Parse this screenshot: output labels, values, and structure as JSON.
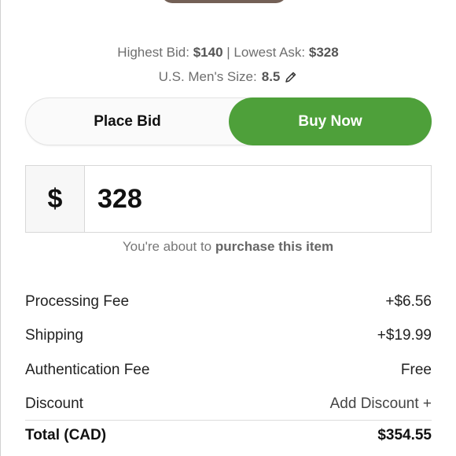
{
  "summary": {
    "highest_bid_label": "Highest Bid:",
    "highest_bid_value": "$140",
    "separator": "|",
    "lowest_ask_label": "Lowest Ask:",
    "lowest_ask_value": "$328",
    "size_label": "U.S. Men's Size:",
    "size_value": "8.5"
  },
  "mode_toggle": {
    "place_bid_label": "Place Bid",
    "buy_now_label": "Buy Now",
    "active": "Buy Now",
    "active_color": "#4ea03a"
  },
  "price_input": {
    "currency_symbol": "$",
    "value": "328"
  },
  "note": {
    "prefix": "You're about to",
    "emphasis": "purchase this item"
  },
  "fees": [
    {
      "label": "Processing Fee",
      "value": "+$6.56"
    },
    {
      "label": "Shipping",
      "value": "+$19.99"
    },
    {
      "label": "Authentication Fee",
      "value": "Free"
    },
    {
      "label": "Discount",
      "value": "Add Discount +"
    }
  ],
  "total": {
    "label": "Total (CAD)",
    "value": "$354.55"
  }
}
